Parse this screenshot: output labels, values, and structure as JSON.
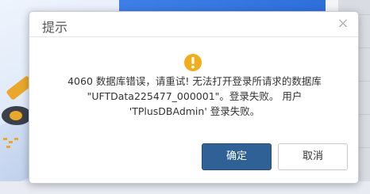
{
  "dialog": {
    "title": "提示",
    "close_icon": "close-icon",
    "warning_icon": "warning-icon",
    "message_lines": [
      "4060 数据库错误，请重试! 无法打开登录所请求的数据库",
      "\"UFTData225477_000001\"。登录失败。 用户",
      "'TPlusDBAdmin' 登录失败。"
    ],
    "ok_label": "确定",
    "cancel_label": "取消"
  },
  "colors": {
    "primary_button": "#2f6196",
    "warning": "#f0ad1c",
    "background_accent": "#3e7fe6"
  }
}
